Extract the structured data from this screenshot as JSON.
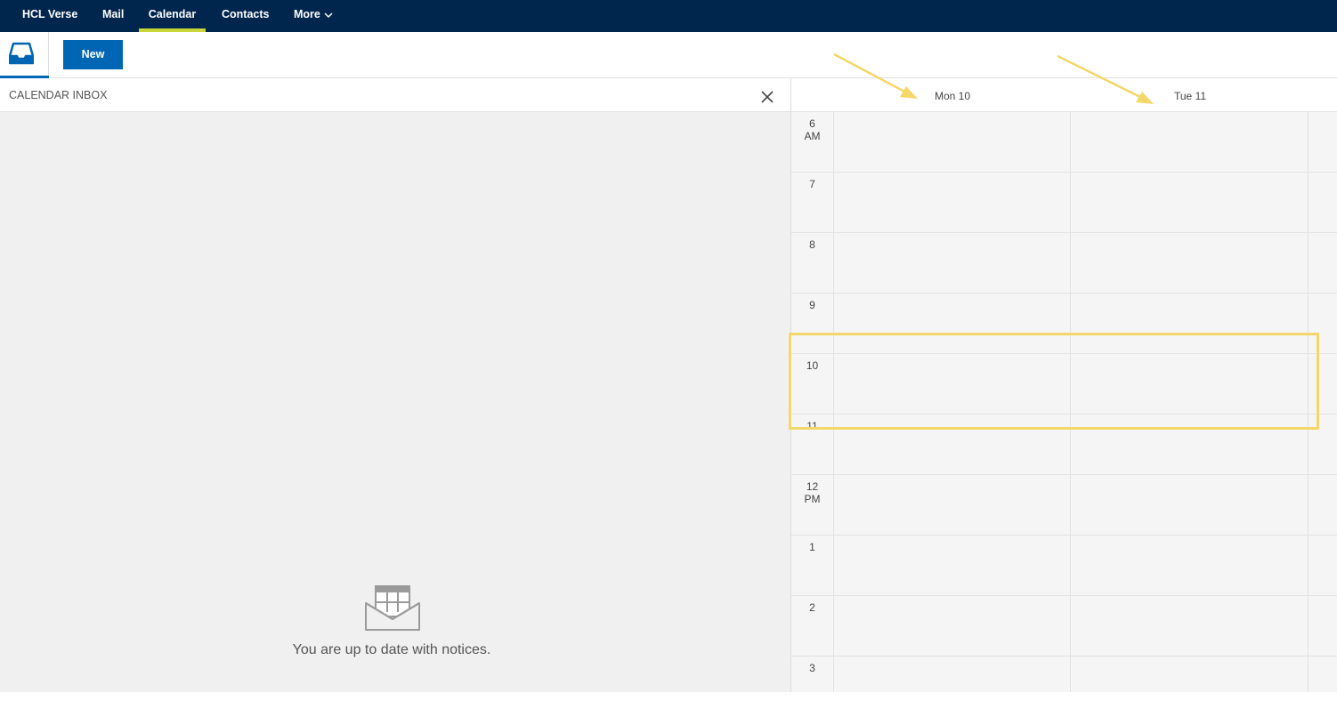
{
  "nav": {
    "items": [
      {
        "label": "HCL Verse"
      },
      {
        "label": "Mail"
      },
      {
        "label": "Calendar"
      },
      {
        "label": "Contacts"
      },
      {
        "label": "More"
      }
    ],
    "active": "Calendar",
    "accent_color": "#c9d63a",
    "background_color": "#00264d"
  },
  "toolbar": {
    "inbox_icon": "calendar-inbox-icon",
    "new_label": "New",
    "brand_color": "#0066b3"
  },
  "calendar_inbox": {
    "title": "CALENDAR INBOX",
    "close_icon": "close-icon",
    "empty_icon": "open-envelope-calendar-icon",
    "empty_message": "You are up to date with notices."
  },
  "calendar": {
    "days": [
      {
        "label": "Mon 10"
      },
      {
        "label": "Tue 11"
      }
    ],
    "hours": [
      {
        "line1": "6",
        "line2": "AM"
      },
      {
        "line1": "7",
        "line2": ""
      },
      {
        "line1": "8",
        "line2": ""
      },
      {
        "line1": "9",
        "line2": ""
      },
      {
        "line1": "10",
        "line2": ""
      },
      {
        "line1": "11",
        "line2": ""
      },
      {
        "line1": "12",
        "line2": "PM"
      },
      {
        "line1": "1",
        "line2": ""
      },
      {
        "line1": "2",
        "line2": ""
      },
      {
        "line1": "3",
        "line2": ""
      }
    ]
  },
  "annotations": {
    "color": "#f5d769"
  }
}
